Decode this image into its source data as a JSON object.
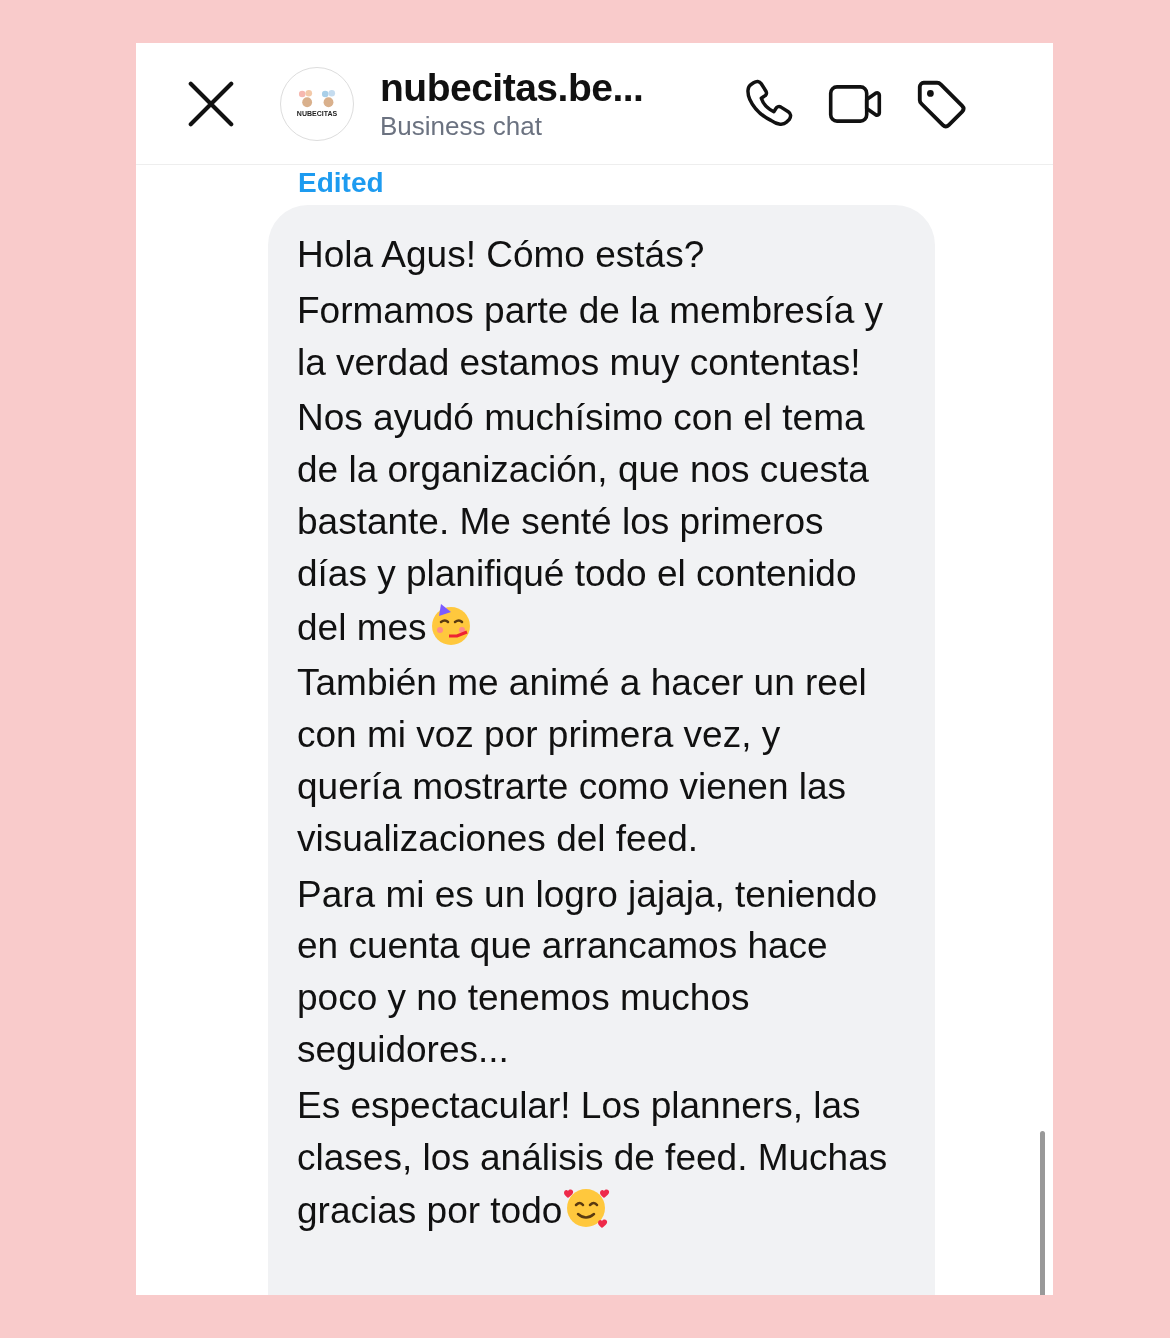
{
  "header": {
    "avatar": {
      "logo": "NUBECITAS"
    },
    "title": "nubecitas.be...",
    "subtitle": "Business chat"
  },
  "message": {
    "status": "Edited",
    "paragraphs": [
      {
        "text": "Hola Agus! Cómo estás?"
      },
      {
        "text": "Formamos parte de la membresía y la verdad estamos muy contentas!"
      },
      {
        "text": "Nos ayudó muchísimo con el tema de la organización, que nos cuesta bastante. Me senté los primeros días y planifiqué todo el contenido del mes",
        "kind": "party"
      },
      {
        "text": "También me animé a hacer un reel con mi voz por primera vez, y quería mostrarte como vienen las visualizaciones del feed."
      },
      {
        "text": "Para mi es un logro jajaja, teniendo en cuenta que arrancamos hace poco y no tenemos muchos seguidores..."
      },
      {
        "text": "Es espectacular! Los planners, las clases, los análisis de feed. Muchas gracias por todo",
        "kind": "hearts"
      }
    ]
  }
}
